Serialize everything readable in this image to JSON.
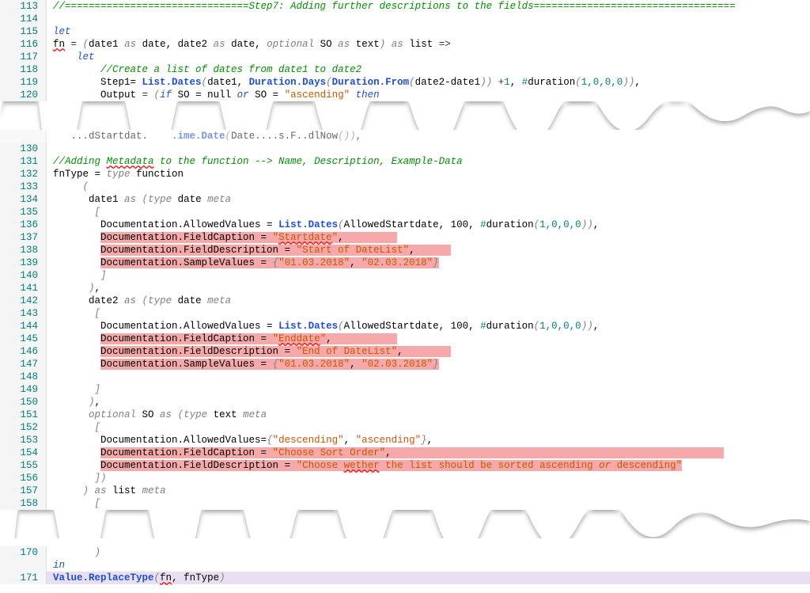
{
  "section1": {
    "lines": [
      {
        "n": "113"
      },
      {
        "n": "114"
      },
      {
        "n": "115"
      },
      {
        "n": "116"
      },
      {
        "n": "117"
      },
      {
        "n": "118"
      },
      {
        "n": "119"
      },
      {
        "n": "120"
      }
    ],
    "l113_comment": "//===============================Step7: Adding further descriptions to the fields==================================",
    "l115_let": "let",
    "l116_fn": "fn",
    "l116_eq": " = ",
    "l116_p_open": "(",
    "l116_date1": "date1 ",
    "l116_as1": "as",
    "l116_date_t1": " date, ",
    "l116_date2": "date2 ",
    "l116_as2": "as",
    "l116_date_t2": " date, ",
    "l116_optional": "optional",
    "l116_so": " SO ",
    "l116_as3": "as",
    "l116_text": " text",
    "l116_p_close": ")",
    "l116_as4": " as",
    "l116_list": " list ",
    "l116_arrow": "=>",
    "l117_let": "let",
    "l118_comment": "//Create a list of dates from date1 to date2",
    "l119_step1": "Step1= ",
    "l119_listdates": "List.Dates",
    "l119_p1": "(",
    "l119_date1": "date1, ",
    "l119_days": "Duration.Days",
    "l119_p2": "(",
    "l119_from": "Duration.From",
    "l119_p3": "(",
    "l119_expr": "date2-date1",
    "l119_p4": "))",
    "l119_plus": " +",
    "l119_one": "1",
    "l119_comma": ", ",
    "l119_hash": "#",
    "l119_dur": "duration",
    "l119_p5": "(",
    "l119_args": "1,0,0,0",
    "l119_p6": "))",
    "l119_comma2": ",",
    "l120_output": "Output ",
    "l120_eq": "= ",
    "l120_p": "(",
    "l120_if": "if",
    "l120_so": " SO = null ",
    "l120_or": "or",
    "l120_so2": " SO = ",
    "l120_asc": "\"ascending\"",
    "l120_then": " then"
  },
  "frag": {
    "prefix": "   ...dStartdat.    ",
    "mid": ".ime.Date",
    "p1": "(",
    "txt": "Date....s.F..dlNow",
    "p2": "())",
    "comma": ","
  },
  "section2": {
    "ln": [
      "130",
      "131",
      "132",
      "133",
      "134",
      "135",
      "136",
      "137",
      "138",
      "139",
      "140",
      "141",
      "142",
      "143",
      "144",
      "145",
      "146",
      "147",
      "148",
      "149",
      "150",
      "151",
      "152",
      "153",
      "154",
      "155",
      "156",
      "157",
      "158"
    ],
    "l131_comment_a": "//Adding ",
    "l131_meta": "Metadata",
    "l131_comment_b": " to the function --> Name, Description, Example-Data",
    "l132_fnt": "fnType = ",
    "l132_type": "type",
    "l132_func": " function",
    "l133_p": "(",
    "l134_d1": "date1 ",
    "l134_as": "as ",
    "l134_p": "(",
    "l134_type": "type",
    "l134_date": " date ",
    "l134_meta": "meta",
    "l135_b": "[",
    "l136_doc": "Documentation.AllowedValues = ",
    "l136_ld": "List.Dates",
    "l136_p": "(",
    "l136_args": "AllowedStartdate, 100, ",
    "l136_hash": "#",
    "l136_dur": "duration",
    "l136_p2": "(",
    "l136_nums": "1,0,0,0",
    "l136_p3": "))",
    "l136_c": ",",
    "l137": "Documentation.FieldCaption = ",
    "l137s": "\"",
    "l137sq": "Startdate",
    "l137e": "\"",
    "l137c": ",",
    "l138": "Documentation.FieldDescription = ",
    "l138s": "\"Start of DateList\"",
    "l138c": ",",
    "l139": "Documentation.SampleValues = ",
    "l139p": "{",
    "l139s1": "\"01.03.2018\"",
    "l139c": ", ",
    "l139s2": "\"02.03.2018\"",
    "l139p2": "}",
    "l140_b": "]",
    "l141_p": ")",
    "l141_c": ",",
    "l142_d2": "date2 ",
    "l142_as": "as ",
    "l142_p": "(",
    "l142_type": "type",
    "l142_date": " date ",
    "l142_meta": "meta",
    "l143_b": "[",
    "l144_doc": "Documentation.AllowedValues = ",
    "l144_ld": "List.Dates",
    "l144_p": "(",
    "l144_args": "AllowedStartdate, 100, ",
    "l144_hash": "#",
    "l144_dur": "duration",
    "l144_p2": "(",
    "l144_nums": "1,0,0,0",
    "l144_p3": "))",
    "l144_c": ",",
    "l145": "Documentation.FieldCaption = ",
    "l145s": "\"",
    "l145sq": "Enddate",
    "l145e": "\"",
    "l145c": ",",
    "l146": "Documentation.FieldDescription = ",
    "l146s": "\"End of DateList\"",
    "l146c": ",",
    "l147": "Documentation.SampleValues = ",
    "l147p": "{",
    "l147s1": "\"01.03.2018\"",
    "l147c": ", ",
    "l147s2": "\"02.03.2018\"",
    "l147p2": "}",
    "l149_b": "]",
    "l150_p": ")",
    "l150_c": ",",
    "l151_opt": "optional",
    "l151_so": " SO ",
    "l151_as": "as ",
    "l151_p": "(",
    "l151_type": "type",
    "l151_text": " text ",
    "l151_meta": "meta",
    "l152_b": "[",
    "l153_doc": "Documentation.AllowedValues=",
    "l153_p": "{",
    "l153_s1": "\"descending\"",
    "l153_c": ", ",
    "l153_s2": "\"ascending\"",
    "l153_p2": "}",
    "l153_cc": ",",
    "l154": "Documentation.FieldCaption = ",
    "l154s": "\"Choose Sort Order\"",
    "l154c": ",",
    "l155": "Documentation.FieldDescription = ",
    "l155s1": "\"Choose ",
    "l155sq": "wether",
    "l155s2": " the list should be sorted ascending ",
    "l155or": "or",
    "l155s3": " descending\"",
    "l156_b": "])",
    "l157_p": ")",
    "l157_as": " as",
    "l157_list": " list ",
    "l157_meta": "meta",
    "l158_b": "["
  },
  "section3": {
    "ln": [
      "170",
      "171"
    ],
    "l170_p": ")",
    "l170_in": "in",
    "l171_vrt": "Value.ReplaceType",
    "l171_p": "(",
    "l171_fn": "fn",
    "l171_c": ", ",
    "l171_ft": "fnType",
    "l171_p2": ")"
  }
}
